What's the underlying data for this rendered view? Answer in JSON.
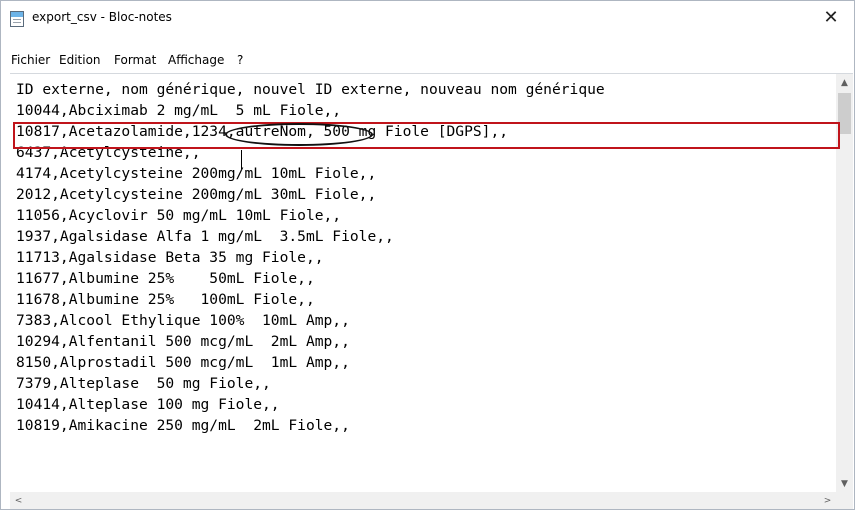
{
  "window": {
    "title": "export_csv - Bloc-notes",
    "close_label": "✕",
    "app_icon": "notepad-icon"
  },
  "menu": [
    {
      "label": "Fichier"
    },
    {
      "label": "Edition"
    },
    {
      "label": "Format"
    },
    {
      "label": "Affichage"
    },
    {
      "label": "?"
    }
  ],
  "editor": {
    "lines": [
      "ID externe, nom générique, nouvel ID externe, nouveau nom générique",
      "10044,Abciximab 2 mg/mL  5 mL Fiole,,",
      "10817,Acetazolamide,1234,autreNom, 500 mg Fiole [DGPS],,",
      "6437,Acetylcysteine,,",
      "4174,Acetylcysteine 200mg/mL 10mL Fiole,,",
      "2012,Acetylcysteine 200mg/mL 30mL Fiole,,",
      "11056,Acyclovir 50 mg/mL 10mL Fiole,,",
      "1937,Agalsidase Alfa 1 mg/mL  3.5mL Fiole,,",
      "11713,Agalsidase Beta 35 mg Fiole,,",
      "11677,Albumine 25%    50mL Fiole,,",
      "11678,Albumine 25%   100mL Fiole,,",
      "7383,Alcool Ethylique 100%  10mL Amp,,",
      "10294,Alfentanil 500 mcg/mL  2mL Amp,,",
      "8150,Alprostadil 500 mcg/mL  1mL Amp,,",
      "7379,Alteplase  50 mg Fiole,,",
      "10414,Alteplase 100 mg Fiole,,",
      "10819,Amikacine 250 mg/mL  2mL Fiole,,"
    ]
  },
  "annotations": {
    "highlight_color": "#c0141b",
    "circle_color": "#111111"
  },
  "scrollbars": {
    "up": "▲",
    "down": "▼",
    "left": "<",
    "right": ">"
  }
}
